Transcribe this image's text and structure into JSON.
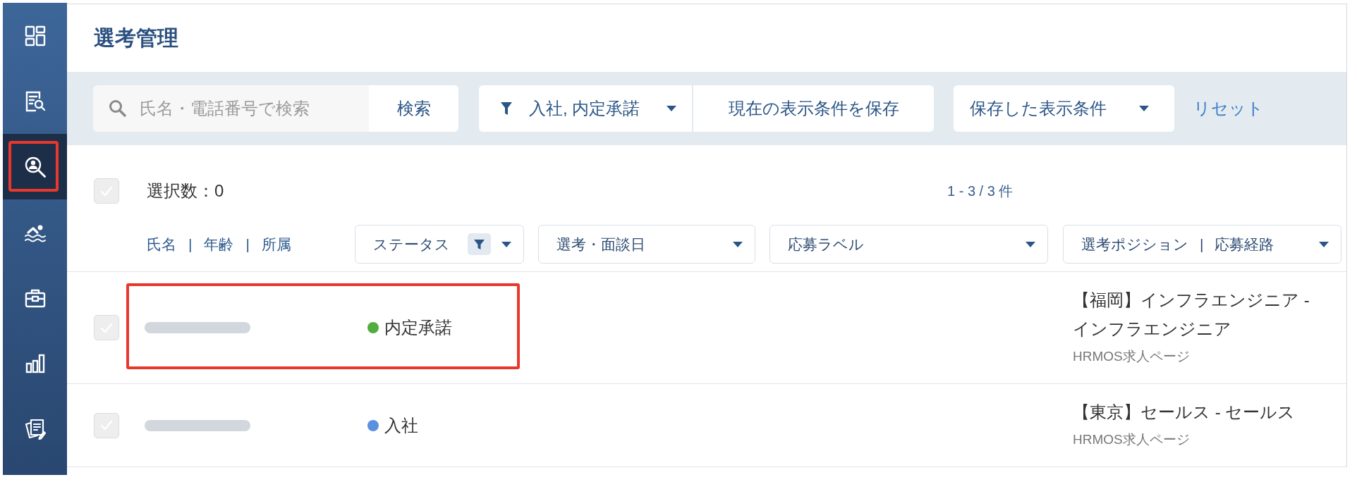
{
  "sidebar": {
    "items": [
      {
        "selected": false,
        "highlighted": false
      },
      {
        "selected": false,
        "highlighted": false
      },
      {
        "selected": true,
        "highlighted": true
      },
      {
        "selected": false,
        "highlighted": false
      },
      {
        "selected": false,
        "highlighted": false
      },
      {
        "selected": false,
        "highlighted": false
      },
      {
        "selected": false,
        "highlighted": false
      }
    ]
  },
  "title": "選考管理",
  "toolbar": {
    "search": {
      "placeholder": "氏名・電話番号で検索",
      "button": "検索"
    },
    "filter": {
      "label": "入社, 内定承諾"
    },
    "save_button": "現在の表示条件を保存",
    "saved_conditions": {
      "label": "保存した表示条件"
    },
    "reset_link": "リセット"
  },
  "selection": {
    "checked": false,
    "label": "選択数：0"
  },
  "result_count": "1 - 3 / 3 件",
  "name_header": [
    {
      "kind": "link",
      "text": "氏名"
    },
    {
      "kind": "separator",
      "text": "|"
    },
    {
      "kind": "link",
      "text": "年齢"
    },
    {
      "kind": "separator",
      "text": "|"
    },
    {
      "kind": "link",
      "text": "所属"
    }
  ],
  "column_filters": [
    {
      "parts": [
        {
          "kind": "label",
          "text": "ステータス"
        }
      ],
      "filtered": true
    },
    {
      "parts": [
        {
          "kind": "label",
          "text": "選考・面談日"
        }
      ],
      "filtered": false
    },
    {
      "parts": [
        {
          "kind": "label",
          "text": "応募ラベル"
        }
      ],
      "filtered": false
    },
    {
      "parts": [
        {
          "kind": "label",
          "text": "選考ポジション"
        },
        {
          "kind": "separator",
          "text": "|"
        },
        {
          "kind": "label",
          "text": "応募経路"
        }
      ],
      "filtered": false
    }
  ],
  "rows": [
    {
      "checked": false,
      "name_blurred": true,
      "highlighted": true,
      "status": {
        "label": "内定承諾",
        "color": "#52ae3c"
      },
      "position": {
        "title": "【福岡】インフラエンジニア - インフラエンジニア",
        "source": "HRMOS求人ページ"
      }
    },
    {
      "checked": false,
      "name_blurred": true,
      "highlighted": false,
      "status": {
        "label": "入社",
        "color": "#5b8fdf"
      },
      "position": {
        "title": "【東京】セールス - セールス",
        "source": "HRMOS求人ページ"
      }
    }
  ]
}
